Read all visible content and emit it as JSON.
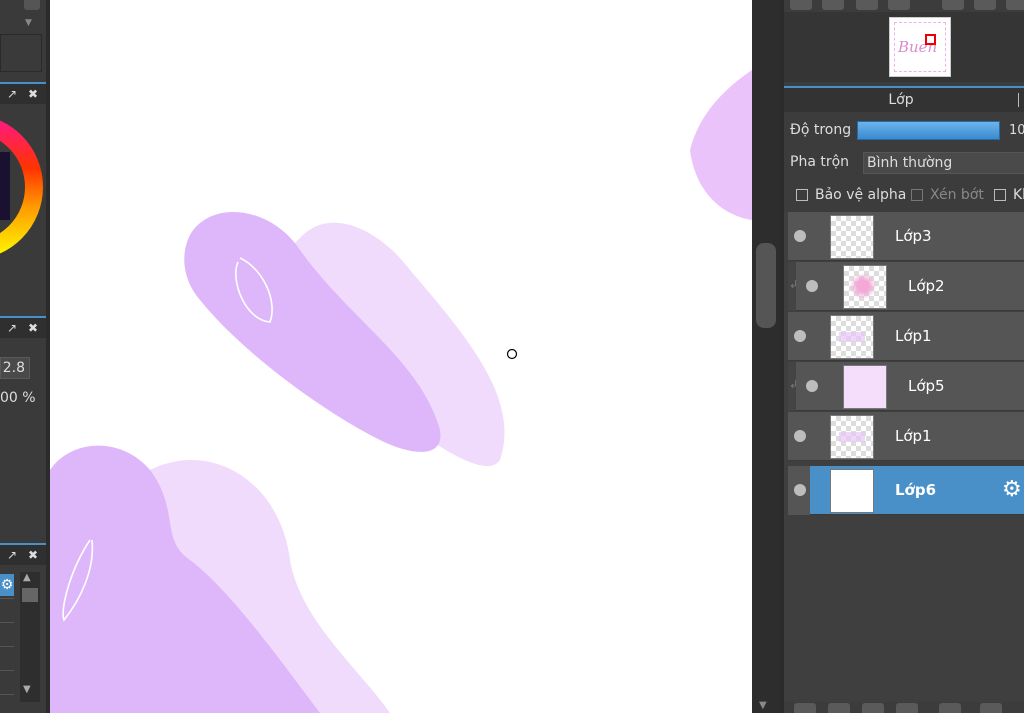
{
  "left_panel": {
    "value_1": "2.8",
    "value_2": "00 %"
  },
  "canvas": {
    "background": "#ffffff",
    "stroke_dark": "#deb6fa",
    "stroke_light": "#f0dbfc"
  },
  "navigator": {
    "thumbnail_text": "Buen"
  },
  "layer_panel": {
    "tab_label": "Lớp",
    "opacity_label": "Độ trong",
    "opacity_value": "10",
    "blend_label": "Pha trộn",
    "blend_value": "Bình thường",
    "protect_alpha": "Bảo vệ alpha",
    "clipping": "Xén bớt",
    "lock_partial": "Kh",
    "layers": [
      {
        "name": "Lớp3",
        "clipped": false,
        "selected": false
      },
      {
        "name": "Lớp2",
        "clipped": true,
        "selected": false
      },
      {
        "name": "Lớp1",
        "clipped": false,
        "selected": false
      },
      {
        "name": "Lớp5",
        "clipped": true,
        "selected": false
      },
      {
        "name": "Lớp1",
        "clipped": false,
        "selected": false
      },
      {
        "name": "Lớp6",
        "clipped": false,
        "selected": true
      }
    ]
  },
  "colors": {
    "accent": "#4a90c8",
    "panel": "#3c3c3c"
  }
}
